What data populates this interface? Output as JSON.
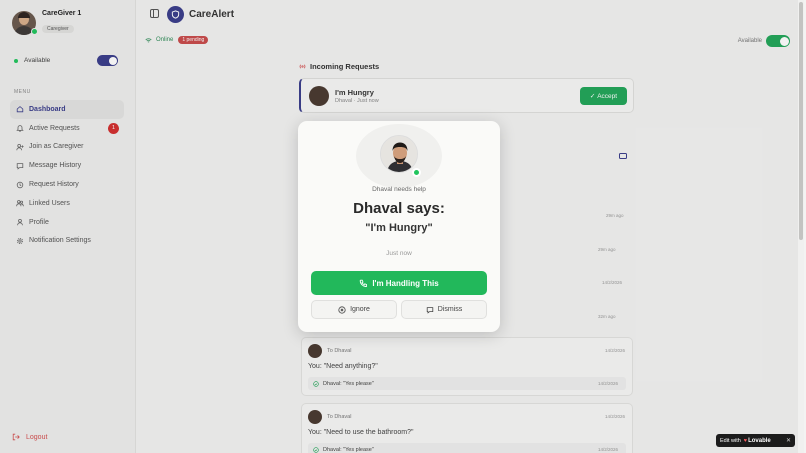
{
  "sidebar": {
    "profile": {
      "name": "CareGiver 1",
      "role": "Caregiver"
    },
    "available_label": "Available",
    "menu_header": "MENU",
    "items": [
      {
        "label": "Dashboard",
        "icon": "home-icon",
        "active": true
      },
      {
        "label": "Active Requests",
        "icon": "bell-icon",
        "badge": "1"
      },
      {
        "label": "Join as Caregiver",
        "icon": "user-plus-icon"
      },
      {
        "label": "Message History",
        "icon": "message-icon"
      },
      {
        "label": "Request History",
        "icon": "history-icon"
      },
      {
        "label": "Linked Users",
        "icon": "users-icon"
      },
      {
        "label": "Profile",
        "icon": "user-icon"
      },
      {
        "label": "Notification Settings",
        "icon": "gear-icon"
      }
    ],
    "logout_label": "Logout"
  },
  "header": {
    "app_title": "CareAlert",
    "online_label": "Online",
    "pending_label": "1 pending",
    "available_label": "Available"
  },
  "main": {
    "incoming_title": "Incoming Requests",
    "request": {
      "title": "I'm Hungry",
      "subtitle": "Dhaval · Just now",
      "accept_label": "Accept"
    },
    "fragments": {
      "time1": "29m ago",
      "time2": "29m ago",
      "date1": "14/2/2026",
      "time3": "32m ago"
    },
    "history": [
      {
        "to": "To Dhaval",
        "date": "14/2/2026",
        "message": "You: \"Need anything?\"",
        "reply": "Dhaval: \"Yes please\"",
        "reply_time": "14/2/2026"
      },
      {
        "to": "To Dhaval",
        "date": "14/2/2026",
        "message": "You: \"Need to use the bathroom?\"",
        "reply": "Dhaval: \"Yes please\"",
        "reply_time": "14/2/2026"
      }
    ]
  },
  "modal": {
    "needs_help": "Dhaval needs help",
    "says": "Dhaval says:",
    "quote": "\"I'm Hungry\"",
    "time": "Just now",
    "handle_label": "I'm Handling This",
    "ignore_label": "Ignore",
    "dismiss_label": "Dismiss"
  },
  "badge": {
    "edit_with": "Edit with",
    "brand": "Lovable"
  },
  "colors": {
    "accent": "#3b3e8c",
    "success": "#22b85b",
    "danger": "#d32f2f"
  }
}
